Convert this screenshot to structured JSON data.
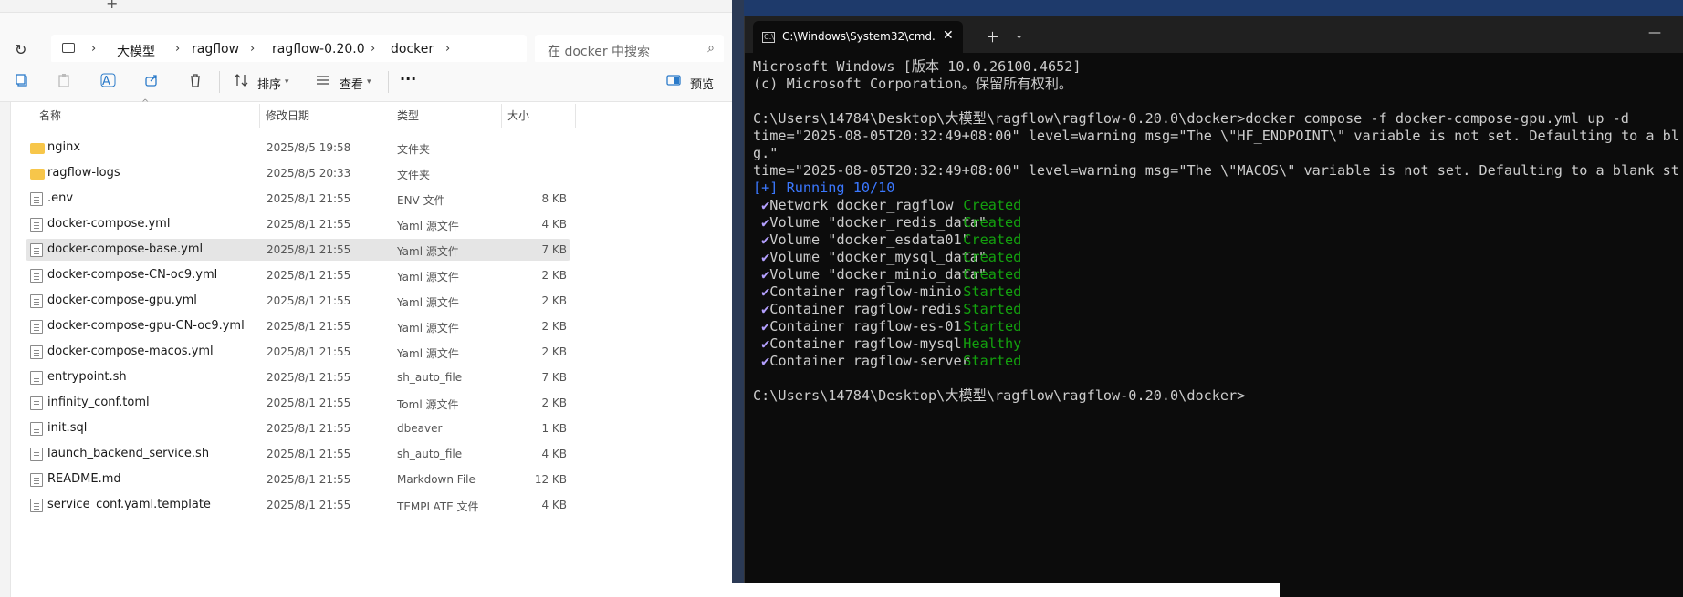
{
  "explorer": {
    "tab_plus": "+",
    "breadcrumb": [
      "大模型",
      "ragflow",
      "ragflow-0.20.0",
      "docker"
    ],
    "search_placeholder": "在 docker 中搜索",
    "toolbar": {
      "sort_label": "排序",
      "view_label": "查看",
      "more_label": "···",
      "preview_label": "预览"
    },
    "columns": {
      "name": "名称",
      "date": "修改日期",
      "type": "类型",
      "size": "大小"
    },
    "files": [
      {
        "name": "nginx",
        "date": "2025/8/5 19:58",
        "type": "文件夹",
        "size": "",
        "kind": "folder"
      },
      {
        "name": "ragflow-logs",
        "date": "2025/8/5 20:33",
        "type": "文件夹",
        "size": "",
        "kind": "folder"
      },
      {
        "name": ".env",
        "date": "2025/8/1 21:55",
        "type": "ENV 文件",
        "size": "8 KB",
        "kind": "file"
      },
      {
        "name": "docker-compose.yml",
        "date": "2025/8/1 21:55",
        "type": "Yaml 源文件",
        "size": "4 KB",
        "kind": "file"
      },
      {
        "name": "docker-compose-base.yml",
        "date": "2025/8/1 21:55",
        "type": "Yaml 源文件",
        "size": "7 KB",
        "kind": "file",
        "selected": true
      },
      {
        "name": "docker-compose-CN-oc9.yml",
        "date": "2025/8/1 21:55",
        "type": "Yaml 源文件",
        "size": "2 KB",
        "kind": "file"
      },
      {
        "name": "docker-compose-gpu.yml",
        "date": "2025/8/1 21:55",
        "type": "Yaml 源文件",
        "size": "2 KB",
        "kind": "file"
      },
      {
        "name": "docker-compose-gpu-CN-oc9.yml",
        "date": "2025/8/1 21:55",
        "type": "Yaml 源文件",
        "size": "2 KB",
        "kind": "file"
      },
      {
        "name": "docker-compose-macos.yml",
        "date": "2025/8/1 21:55",
        "type": "Yaml 源文件",
        "size": "2 KB",
        "kind": "file"
      },
      {
        "name": "entrypoint.sh",
        "date": "2025/8/1 21:55",
        "type": "sh_auto_file",
        "size": "7 KB",
        "kind": "file"
      },
      {
        "name": "infinity_conf.toml",
        "date": "2025/8/1 21:55",
        "type": "Toml 源文件",
        "size": "2 KB",
        "kind": "file"
      },
      {
        "name": "init.sql",
        "date": "2025/8/1 21:55",
        "type": "dbeaver",
        "size": "1 KB",
        "kind": "file"
      },
      {
        "name": "launch_backend_service.sh",
        "date": "2025/8/1 21:55",
        "type": "sh_auto_file",
        "size": "4 KB",
        "kind": "file"
      },
      {
        "name": "README.md",
        "date": "2025/8/1 21:55",
        "type": "Markdown File",
        "size": "12 KB",
        "kind": "file"
      },
      {
        "name": "service_conf.yaml.template",
        "date": "2025/8/1 21:55",
        "type": "TEMPLATE 文件",
        "size": "4 KB",
        "kind": "file"
      }
    ]
  },
  "terminal": {
    "tab_title": "C:\\Windows\\System32\\cmd.e>",
    "lines": [
      {
        "text": "Microsoft Windows [版本 10.0.26100.4652]",
        "color": "default"
      },
      {
        "text": "(c) Microsoft Corporation。保留所有权利。",
        "color": "default"
      },
      {
        "text": "",
        "color": "default"
      },
      {
        "text": "C:\\Users\\14784\\Desktop\\大模型\\ragflow\\ragflow-0.20.0\\docker>docker compose -f docker-compose-gpu.yml up -d",
        "color": "default"
      },
      {
        "text": "time=\"2025-08-05T20:32:49+08:00\" level=warning msg=\"The \\\"HF_ENDPOINT\\\" variable is not set. Defaulting to a blank",
        "color": "default"
      },
      {
        "text": "g.\"",
        "color": "default"
      },
      {
        "text": "time=\"2025-08-05T20:32:49+08:00\" level=warning msg=\"The \\\"MACOS\\\" variable is not set. Defaulting to a blank strin",
        "color": "default"
      },
      {
        "text": "[+] Running 10/10",
        "color": "blue"
      }
    ],
    "status_rows": [
      {
        "label": "Network docker_ragflow",
        "status": "Created"
      },
      {
        "label": "Volume \"docker_redis_data\"",
        "status": "Created"
      },
      {
        "label": "Volume \"docker_esdata01\"",
        "status": "Created"
      },
      {
        "label": "Volume \"docker_mysql_data\"",
        "status": "Created"
      },
      {
        "label": "Volume \"docker_minio_data\"",
        "status": "Created"
      },
      {
        "label": "Container ragflow-minio",
        "status": "Started"
      },
      {
        "label": "Container ragflow-redis",
        "status": "Started"
      },
      {
        "label": "Container ragflow-es-01",
        "status": "Started"
      },
      {
        "label": "Container ragflow-mysql",
        "status": "Healthy"
      },
      {
        "label": "Container ragflow-server",
        "status": "Started"
      }
    ],
    "prompt": "C:\\Users\\14784\\Desktop\\大模型\\ragflow\\ragflow-0.20.0\\docker>"
  },
  "colors": {
    "terminal_bg": "#0c0c0c",
    "status_green": "#13a10e",
    "running_blue": "#3b78ff",
    "folder_yellow": "#f7c64a"
  }
}
